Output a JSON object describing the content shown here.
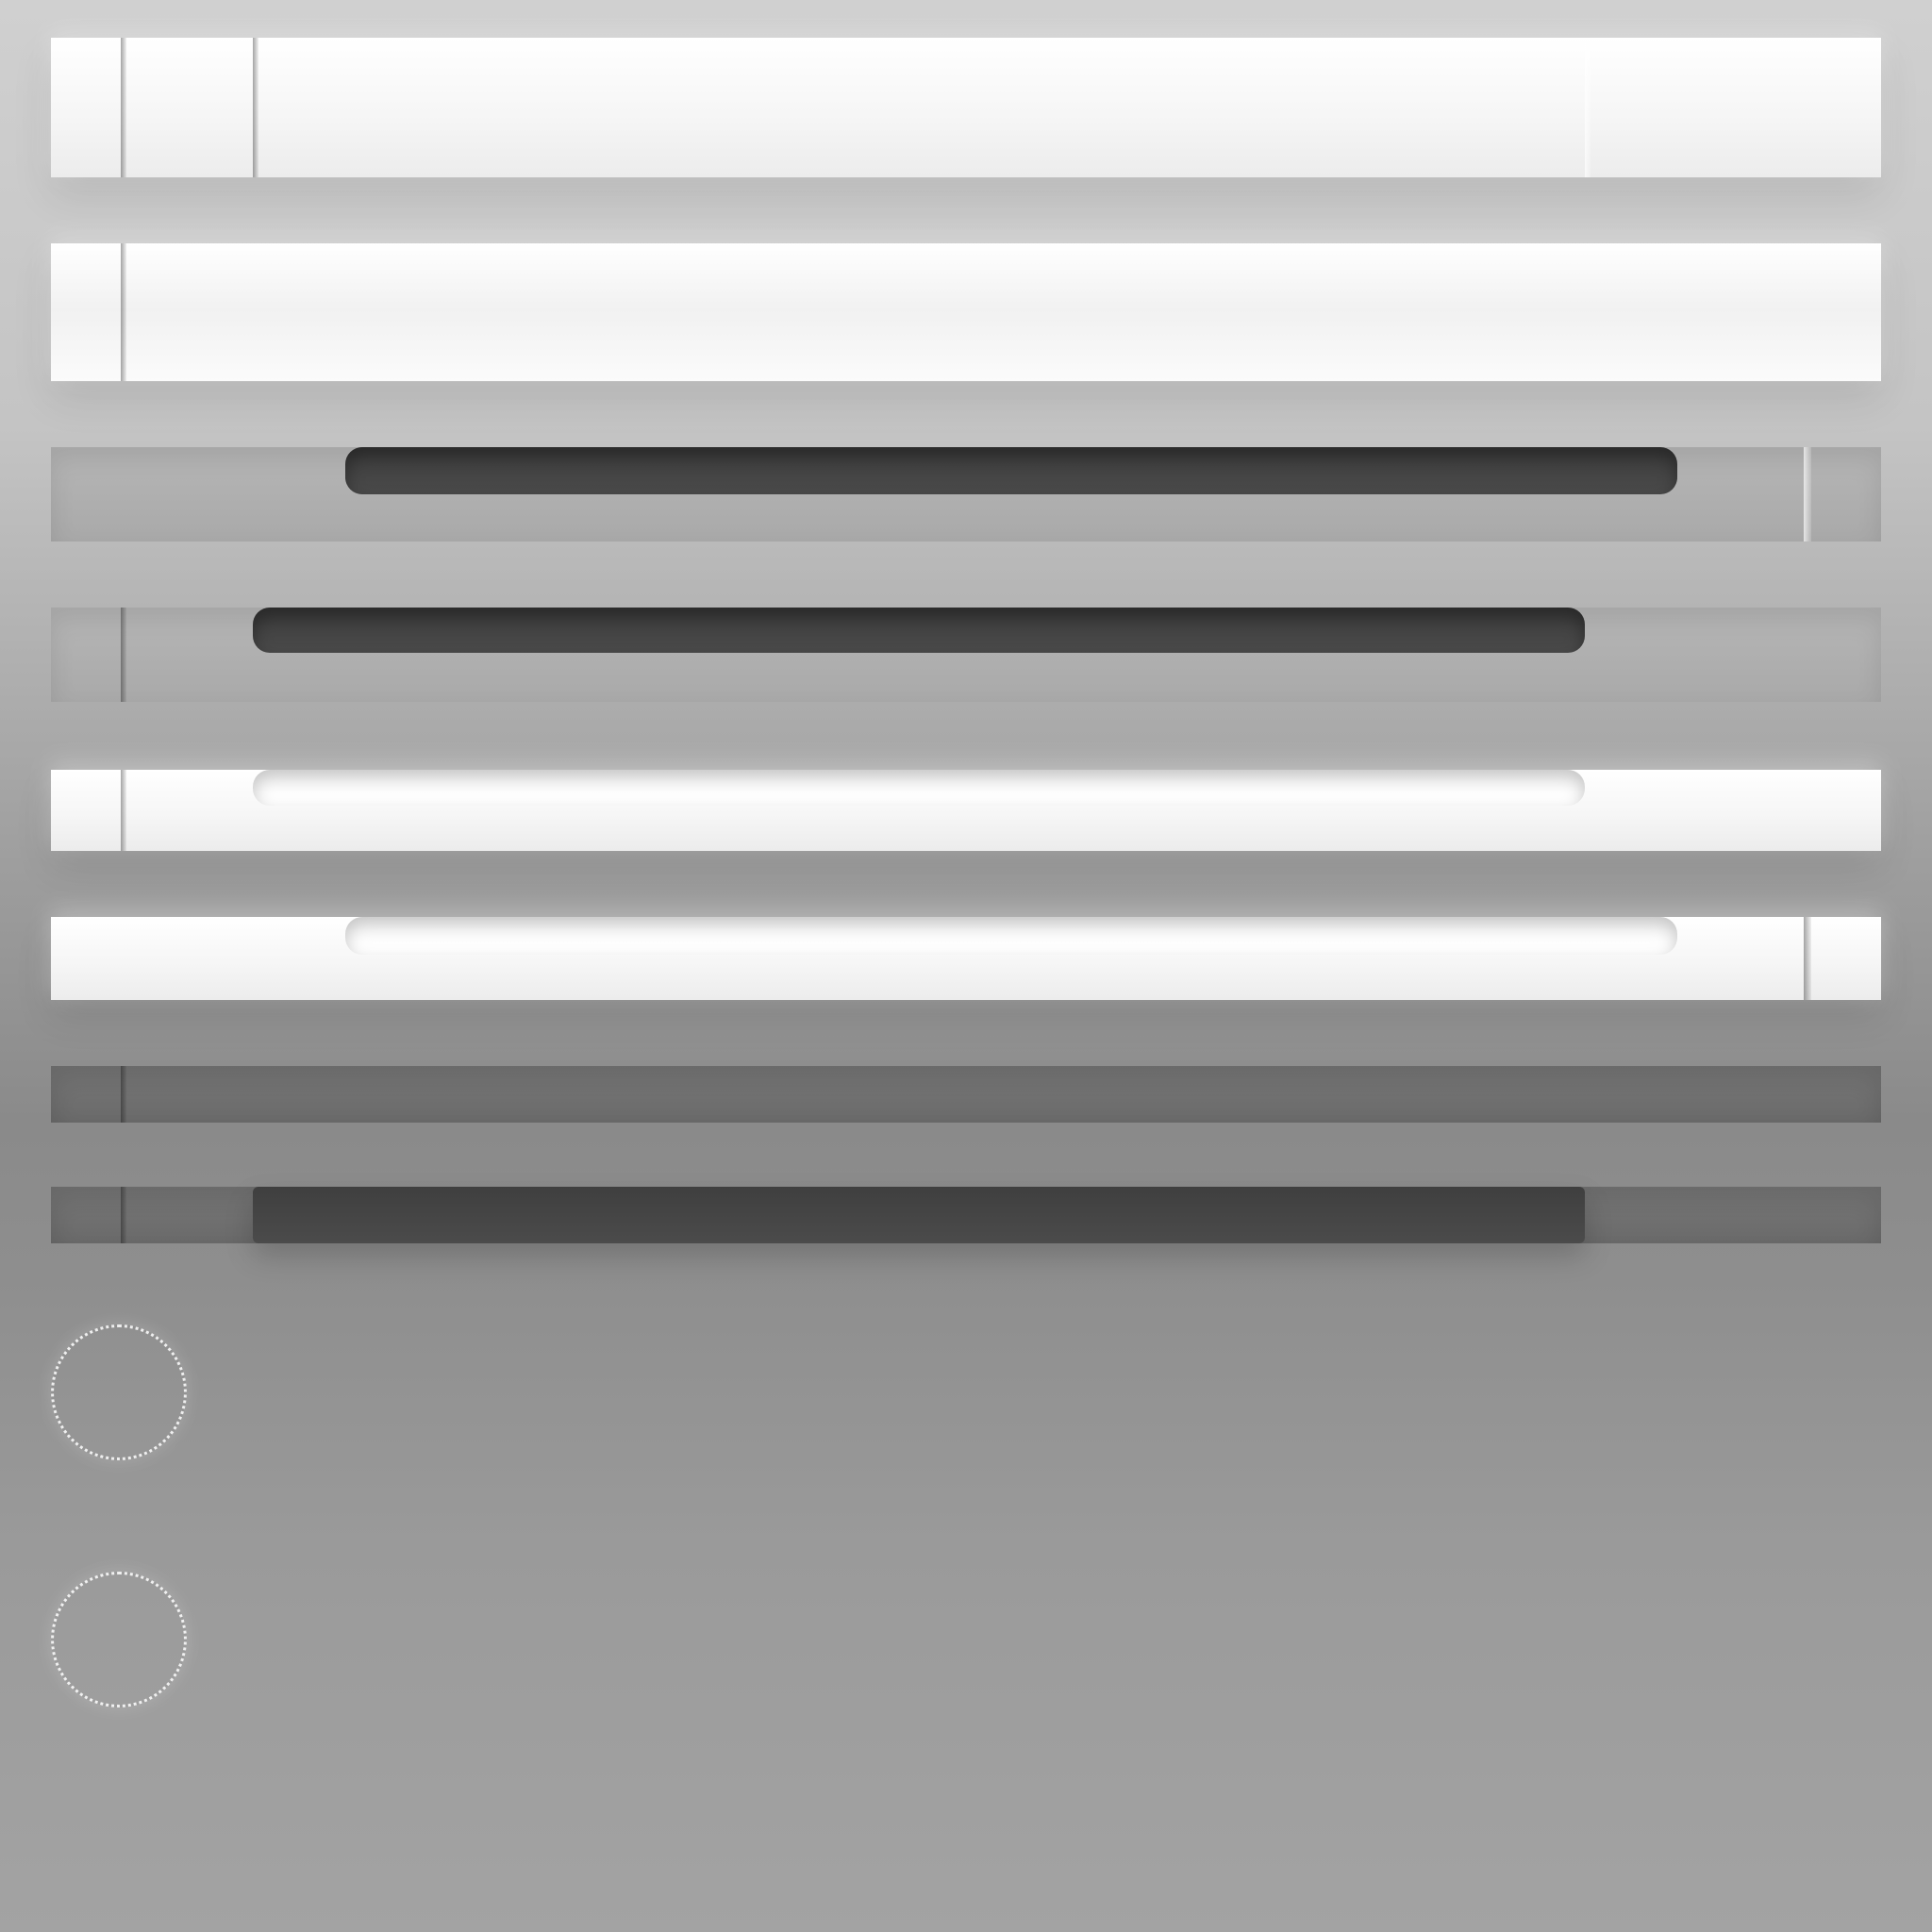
{
  "scene": {
    "description_text": "",
    "elements": {
      "rows": [
        {
          "kind": "light-band"
        },
        {
          "kind": "light-band"
        },
        {
          "kind": "mid-band-with-dark-inset"
        },
        {
          "kind": "mid-band-with-dark-inset"
        },
        {
          "kind": "light-band-with-light-inset"
        },
        {
          "kind": "light-band-with-light-inset"
        },
        {
          "kind": "dark-thin-band"
        },
        {
          "kind": "dark-thin-band-with-dark-inset"
        }
      ],
      "radios": [
        {
          "kind": "ring"
        },
        {
          "kind": "ring"
        }
      ]
    }
  }
}
